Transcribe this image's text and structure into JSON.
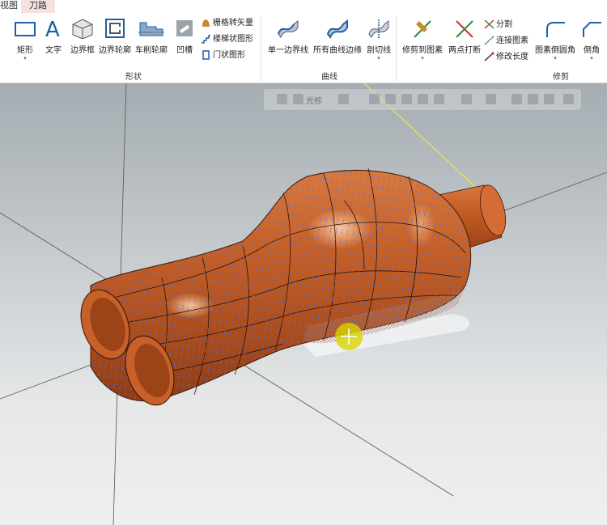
{
  "tabs": [
    {
      "label": "视图",
      "active": false
    },
    {
      "label": "刀路",
      "active": true
    }
  ],
  "ribbon": {
    "groups": [
      {
        "label": "形状"
      },
      {
        "label": "曲线"
      },
      {
        "label": "修剪"
      }
    ],
    "shape_buttons": [
      {
        "label": "矩形",
        "icon": "rectangle-icon",
        "has_dropdown": true
      },
      {
        "label": "文字",
        "icon": "text-icon",
        "has_dropdown": false
      },
      {
        "label": "边界框",
        "icon": "bounding-box-icon",
        "has_dropdown": false
      },
      {
        "label": "边界轮廓",
        "icon": "boundary-outline-icon",
        "has_dropdown": false
      },
      {
        "label": "车削轮廓",
        "icon": "turn-profile-icon",
        "has_dropdown": false
      },
      {
        "label": "凹槽",
        "icon": "groove-icon",
        "has_dropdown": false
      }
    ],
    "shape_small_buttons": [
      {
        "label": "栅格转矢量",
        "icon": "raster-to-vector-icon"
      },
      {
        "label": "楼梯状图形",
        "icon": "stair-shape-icon"
      },
      {
        "label": "门状图形",
        "icon": "door-shape-icon"
      }
    ],
    "curve_buttons": [
      {
        "label": "单一边界线",
        "icon": "single-edge-curve-icon"
      },
      {
        "label": "所有曲线边缘",
        "icon": "all-curve-edges-icon"
      },
      {
        "label": "剖切线",
        "icon": "section-curve-icon",
        "has_dropdown": true
      }
    ],
    "trim_buttons": [
      {
        "label": "修剪到图素",
        "icon": "trim-to-entity-icon",
        "has_dropdown": true
      },
      {
        "label": "两点打断",
        "icon": "break-two-points-icon",
        "has_dropdown": false
      }
    ],
    "trim_small_buttons": [
      {
        "label": "分割",
        "icon": "divide-icon"
      },
      {
        "label": "连接图素",
        "icon": "join-entities-icon"
      },
      {
        "label": "修改长度",
        "icon": "modify-length-icon"
      }
    ],
    "trim_right_buttons": [
      {
        "label": "图素倒圆角",
        "icon": "fillet-entities-icon",
        "has_dropdown": true
      },
      {
        "label": "倒角",
        "icon": "chamfer-icon",
        "has_dropdown": true
      }
    ]
  },
  "viewport": {
    "floating_toolbar": {
      "cursor_label": "光标"
    },
    "colors": {
      "part": "#c8632a",
      "toolpath": "#2f6fe0",
      "axis_yellow": "#e8e84a",
      "cursor_highlight": "#d8d400"
    }
  }
}
